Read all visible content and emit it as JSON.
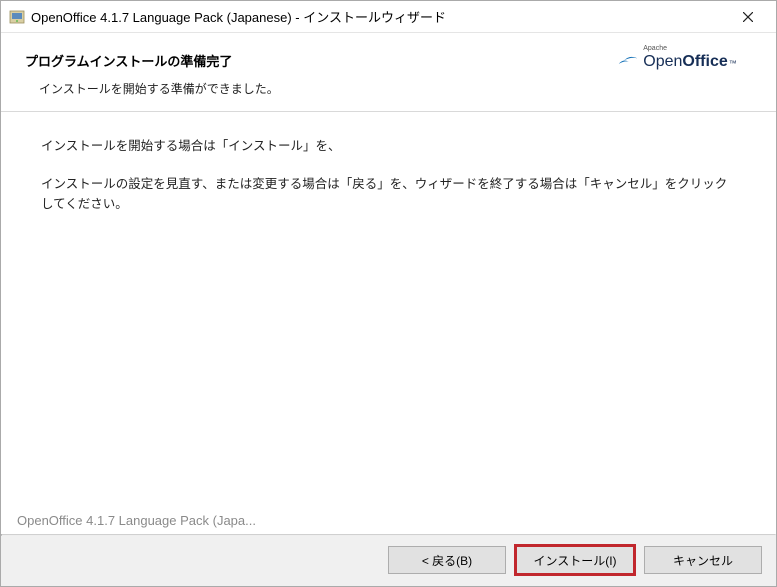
{
  "titlebar": {
    "title": "OpenOffice 4.1.7 Language Pack (Japanese) - インストールウィザード"
  },
  "header": {
    "heading": "プログラムインストールの準備完了",
    "sub": "インストールを開始する準備ができました。"
  },
  "logo": {
    "apache": "Apache",
    "open": "Open",
    "office": "Office",
    "tm": "™"
  },
  "content": {
    "p1": "インストールを開始する場合は「インストール」を、",
    "p2": "インストールの設定を見直す、または変更する場合は「戻る」を、ウィザードを終了する場合は「キャンセル」をクリックしてください。"
  },
  "footer": {
    "brand": "OpenOffice 4.1.7 Language Pack (Japa..."
  },
  "buttons": {
    "back": "< 戻る(B)",
    "install": "インストール(I)",
    "cancel": "キャンセル"
  }
}
